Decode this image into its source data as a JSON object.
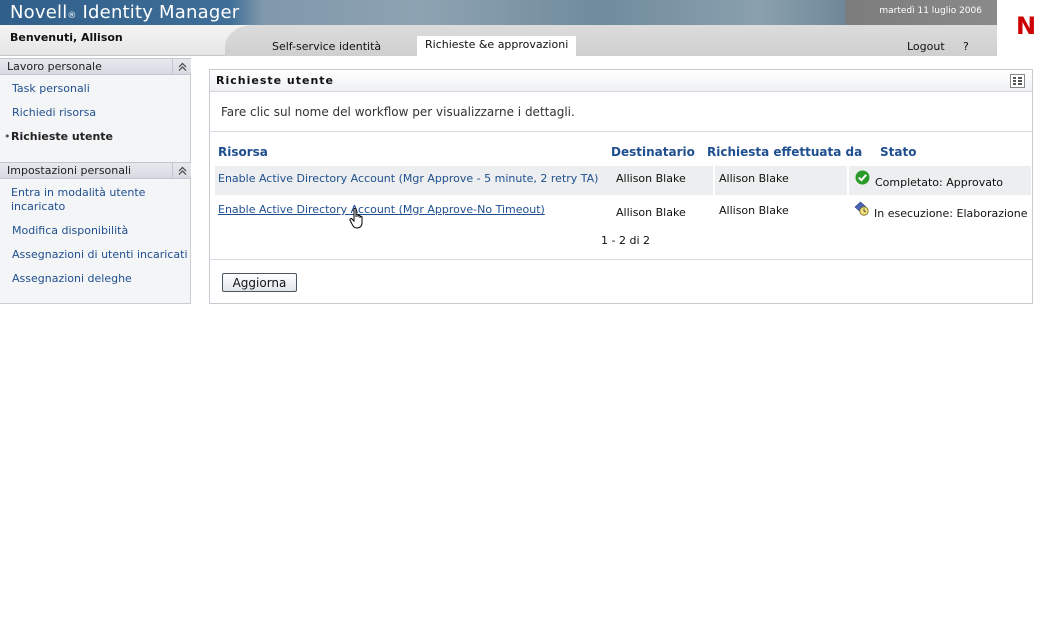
{
  "header": {
    "app_name": "Novell",
    "reg_mark": "®",
    "app_product": " Identity Manager",
    "date": "martedì 11 luglio 2006",
    "welcome": "Benvenuti, Allison",
    "logo_letter": "N",
    "tabs": [
      {
        "label": "Self-service identità",
        "active": false
      },
      {
        "label": "Richieste &e approvazioni",
        "active": true
      }
    ],
    "logout_label": "Logout",
    "help_label": "?"
  },
  "sidebar": {
    "sections": [
      {
        "title": "Lavoro personale",
        "items": [
          {
            "label": "Task personali",
            "active": false
          },
          {
            "label": "Richiedi risorsa",
            "active": false
          },
          {
            "label": "Richieste utente",
            "active": true
          }
        ]
      },
      {
        "title": "Impostazioni personali",
        "items": [
          {
            "label": "Entra in modalità utente",
            "label2": "incaricato",
            "active": false
          },
          {
            "label": "Modifica disponibilità",
            "active": false
          },
          {
            "label": "Assegnazioni di utenti incaricati",
            "active": false
          },
          {
            "label": "Assegnazioni deleghe",
            "active": false
          }
        ]
      }
    ],
    "bullet": "•",
    "collapse_icon": "double-chevron-up-icon"
  },
  "main": {
    "title": "Richieste utente",
    "description": "Fare clic sul nome del workflow per visualizzarne i dettagli.",
    "columns": [
      "Risorsa",
      "Destinatario",
      "Richiesta effettuata da",
      "Stato"
    ],
    "rows": [
      {
        "resource": "Enable Active Directory Account (Mgr Approve - 5 minute, 2 retry TA)",
        "recipient": "Allison Blake",
        "requested_by": "Allison Blake",
        "status": "Completato: Approvato",
        "status_icon": "check-circle-icon"
      },
      {
        "resource": "Enable Active Directory Account (Mgr Approve-No Timeout)",
        "recipient": "Allison Blake",
        "requested_by": "Allison Blake",
        "status": "In esecuzione: Elaborazione",
        "status_icon": "processing-clock-icon"
      }
    ],
    "pager": "1 - 2 di 2",
    "refresh_button": "Aggiorna"
  },
  "colors": {
    "link": "#1f4f8f",
    "banner": "#2f5f8a",
    "logo_red": "#cc0000",
    "check_green": "#2a9a2a"
  }
}
